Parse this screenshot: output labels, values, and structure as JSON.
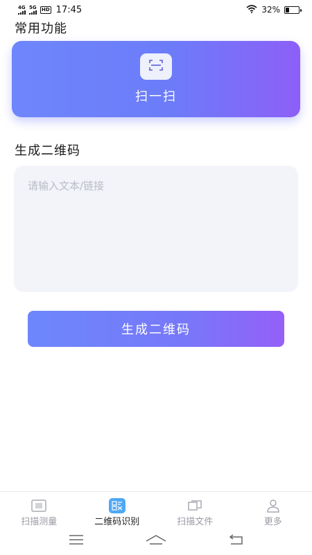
{
  "status_bar": {
    "network_1": "4G",
    "network_2": "5G",
    "hd_label": "HD",
    "time": "17:45",
    "battery_percent": "32%",
    "battery_level": 0.32
  },
  "common_section": {
    "title": "常用功能",
    "scan_card_label": "扫一扫"
  },
  "generate_section": {
    "title": "生成二维码",
    "input_placeholder": "请输入文本/链接",
    "input_value": "",
    "button_label": "生成二维码"
  },
  "tabs": [
    {
      "label": "扫描测量",
      "icon": "scan-frame-icon",
      "active": false
    },
    {
      "label": "二维码识别",
      "icon": "qr-recognize-icon",
      "active": true
    },
    {
      "label": "扫描文件",
      "icon": "file-scan-icon",
      "active": false
    },
    {
      "label": "更多",
      "icon": "person-icon",
      "active": false
    }
  ],
  "colors": {
    "accent_start": "#6e86fb",
    "accent_end": "#9460f8",
    "active_tab_badge": "#4fa8f5",
    "input_bg": "#f3f4f9"
  }
}
